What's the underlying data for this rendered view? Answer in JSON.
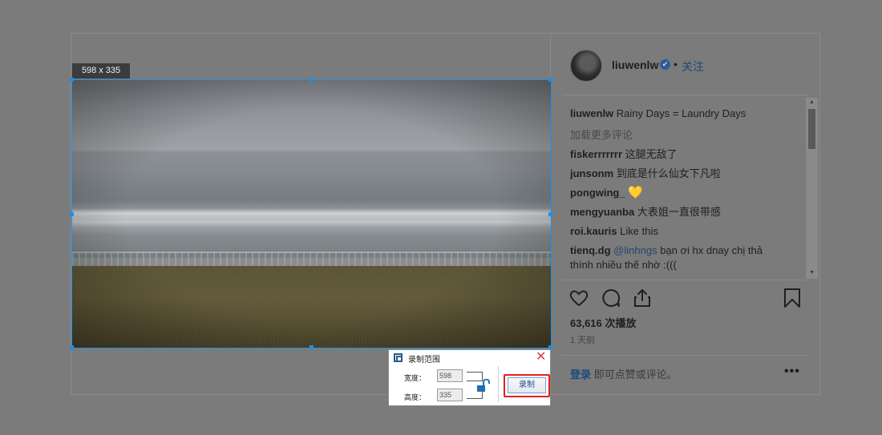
{
  "capture": {
    "size_label": "598 x 335"
  },
  "post": {
    "username": "liuwenlw",
    "verified_mark": "✔",
    "dot": "•",
    "follow_label": "关注",
    "caption_user": "liuwenlw",
    "caption_text": "Rainy Days = Laundry Days",
    "load_more": "加载更多评论",
    "comments": [
      {
        "user": "fiskerrrrrrr",
        "text": "这腿无敌了"
      },
      {
        "user": "junsonm",
        "text": "到底是什么仙女下凡啦"
      },
      {
        "user": "pongwing_",
        "text": "💛"
      },
      {
        "user": "mengyuanba",
        "text": "大表姐一直很带感"
      },
      {
        "user": "roi.kauris",
        "text": "Like this"
      },
      {
        "user": "tienq.dg",
        "mention": "@linhngs",
        "text": "bạn ơi hx dnay chị thả thính nhiều thế nhờ :((("
      }
    ],
    "icons": {
      "like": "heart-icon",
      "comment": "comment-icon",
      "share": "share-icon",
      "save": "bookmark-icon",
      "more": "more-icon"
    },
    "views": "63,616 次播放",
    "time_ago": "1 天前",
    "login_link": "登录",
    "login_suffix": "即可点赞或评论。",
    "more_dots": "•••"
  },
  "record_dialog": {
    "title": "录制范围",
    "close_glyph": "✕",
    "width_label": "宽度：",
    "width_value": "598",
    "height_label": "高度：",
    "height_value": "335",
    "record_label": "录制"
  },
  "colors": {
    "selection": "#1e8fe8",
    "highlight": "#e02020",
    "link": "#1d4a7a"
  }
}
